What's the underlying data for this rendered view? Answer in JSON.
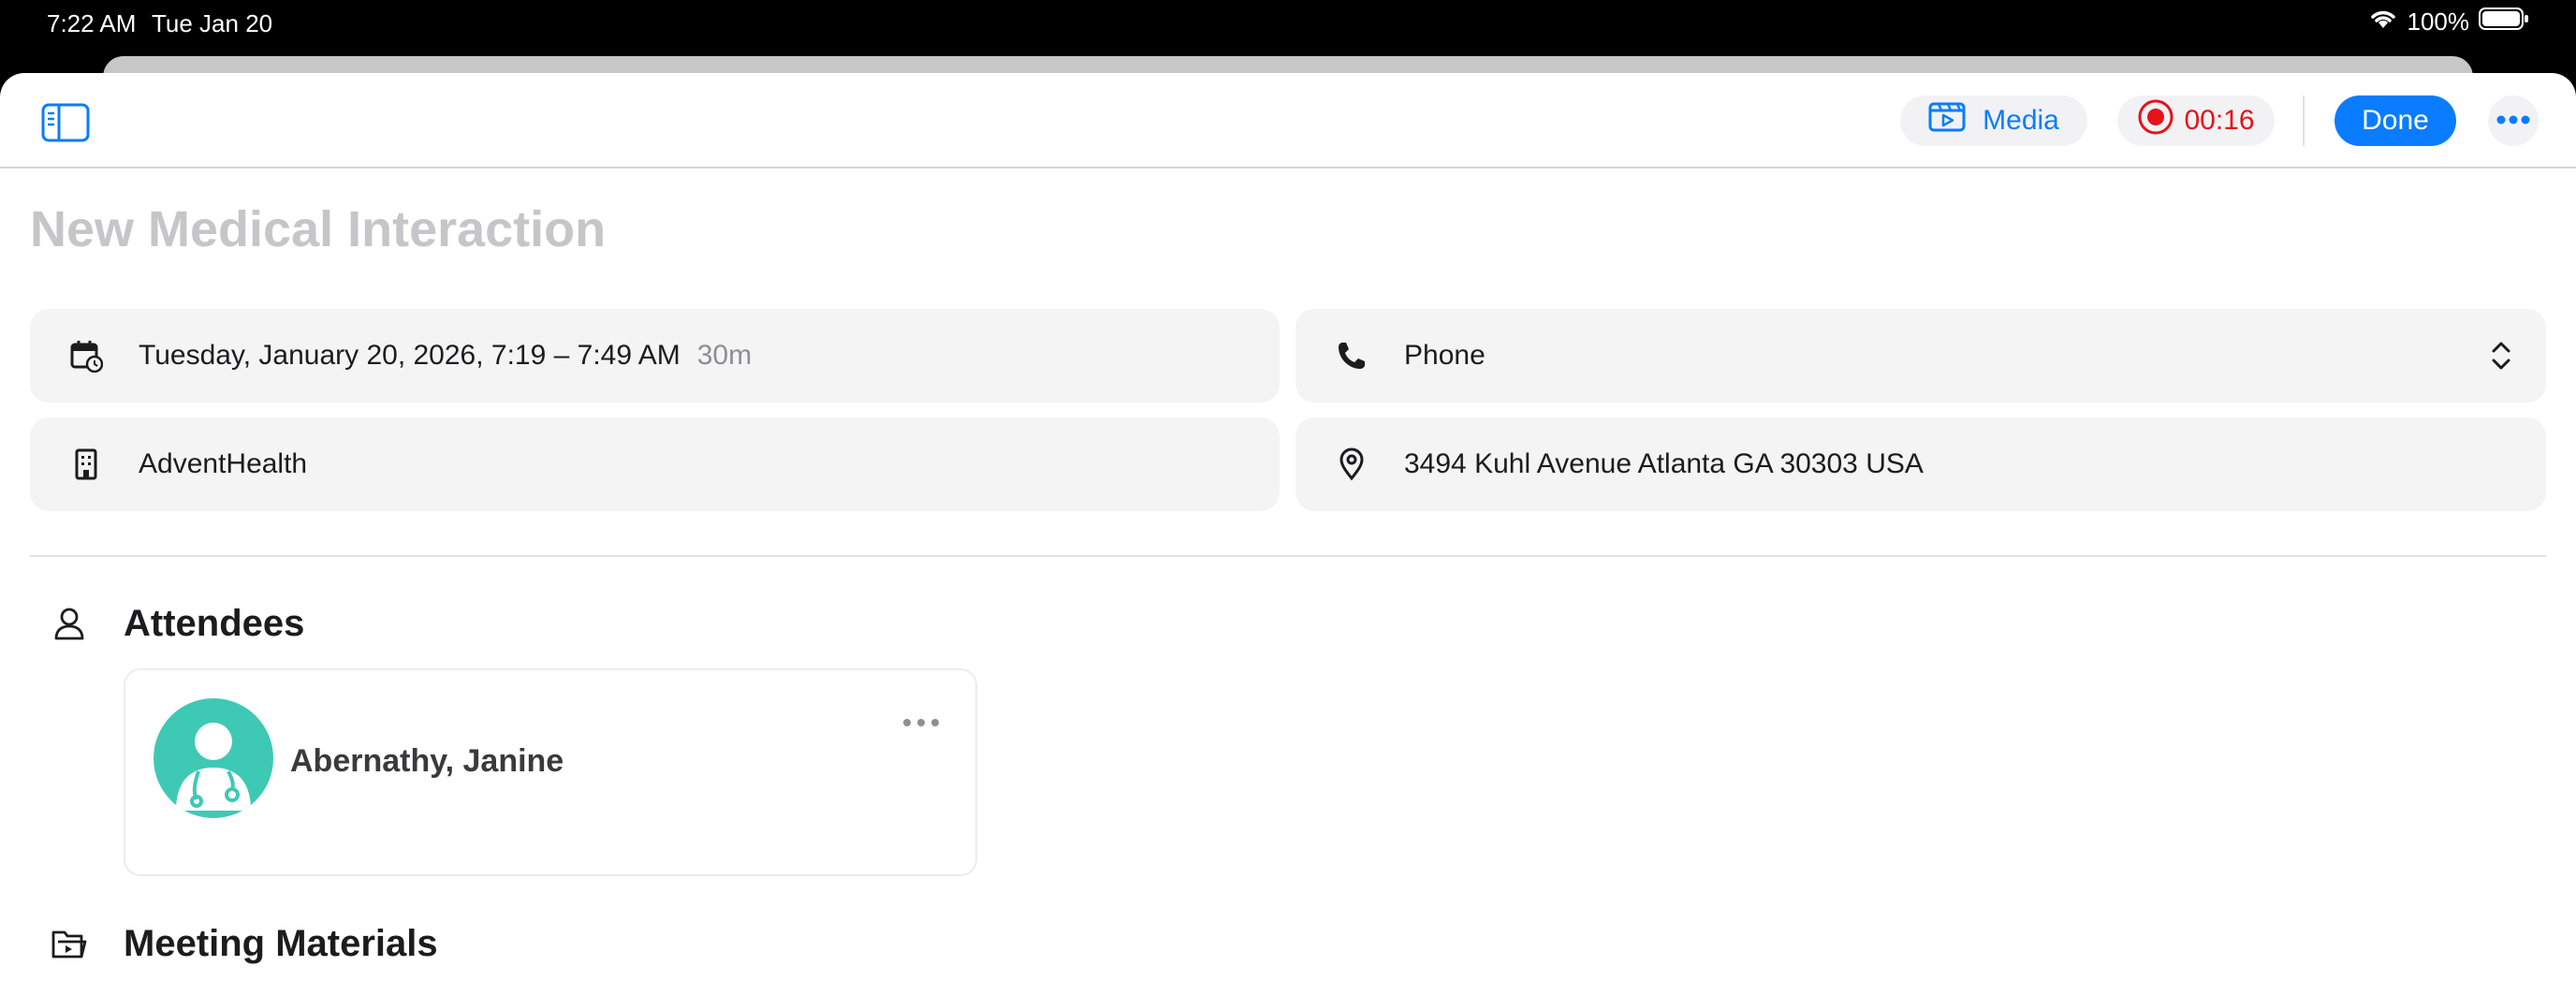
{
  "status_bar": {
    "time": "7:22 AM",
    "date": "Tue Jan 20",
    "battery": "100%"
  },
  "toolbar": {
    "media_label": "Media",
    "record_time": "00:16",
    "done_label": "Done"
  },
  "page": {
    "title_placeholder": "New Medical Interaction"
  },
  "fields": {
    "datetime": "Tuesday, January 20, 2026, 7:19 – 7:49 AM",
    "duration": "30m",
    "channel": "Phone",
    "organization": "AdventHealth",
    "address": "3494 Kuhl Avenue Atlanta GA 30303 USA"
  },
  "attendees": {
    "heading": "Attendees",
    "items": [
      {
        "name": "Abernathy, Janine"
      }
    ]
  },
  "materials": {
    "heading": "Meeting Materials"
  },
  "colors": {
    "accent": "#0a7cff",
    "record": "#e4141a",
    "avatar": "#3ec9b5"
  }
}
